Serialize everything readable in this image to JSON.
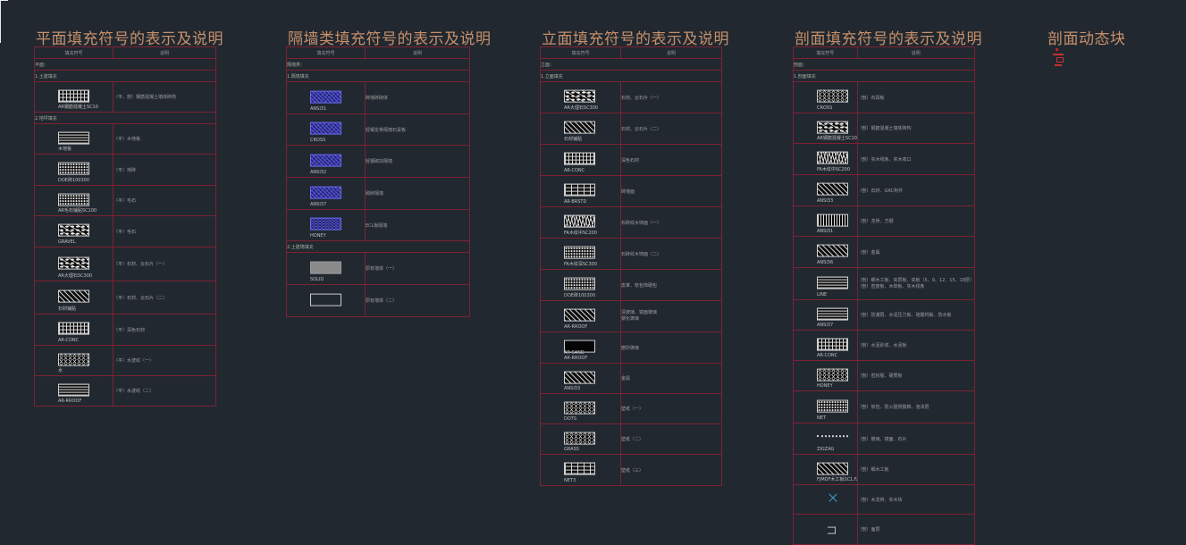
{
  "titles": {
    "plan": "平面填充符号的表示及说明",
    "partition": "隔墙类填充符号的表示及说明",
    "elevation": "立面填充符号的表示及说明",
    "section": "剖面填充符号的表示及说明",
    "dynamic": "剖面动态块"
  },
  "headers": {
    "symbol": "填充符号",
    "desc": "说明"
  },
  "plan": {
    "intro": "平面：",
    "sect1": "1.土建填充",
    "sect2": "2.地坪填充",
    "rows": [
      {
        "pattern": "grid",
        "caption": "AR钢筋混凝土SC10",
        "desc": "（平、剖）钢筋混凝土墙体砖构"
      },
      {
        "pattern": "hlines",
        "caption": "木地板",
        "desc": "（平）木地板"
      },
      {
        "pattern": "dots",
        "caption": "DOE砖100300",
        "desc": "（平）地砖"
      },
      {
        "pattern": "dots",
        "caption": "AR毛石铺贴SC100",
        "desc": "（平）毛石"
      },
      {
        "pattern": "stone",
        "caption": "GRAVEL",
        "desc": "（平）毛石"
      },
      {
        "pattern": "stone",
        "caption": "AR大理石SC300",
        "desc": "（平）石材、云石片（一）"
      },
      {
        "pattern": "diag",
        "caption": "石材铺贴",
        "desc": "（平）石材、云石片（二）"
      },
      {
        "pattern": "grid",
        "caption": "AR-CONC",
        "desc": "（平）深色石材"
      },
      {
        "pattern": "circles",
        "caption": "水",
        "desc": "（平）水波纹（一）"
      },
      {
        "pattern": "hlines",
        "caption": "AR-RROOF",
        "desc": "（平）水波纹（二）"
      }
    ]
  },
  "partition": {
    "intro": "隔墙类：",
    "sect1": "1.隔墙填充",
    "sect2": "2.土建墙填充",
    "rows": [
      {
        "pattern": "blue",
        "caption": "ANSI31",
        "desc": "砖墙砖砌体"
      },
      {
        "pattern": "blue",
        "caption": "CROSS",
        "desc": "轻钢龙骨隔墙石膏板"
      },
      {
        "pattern": "blue",
        "caption": "ANSI32",
        "desc": "轻钢砌块隔墙"
      },
      {
        "pattern": "blue",
        "caption": "ANSI37",
        "desc": "砌砖隔墙"
      },
      {
        "pattern": "blue-hex",
        "caption": "HONEY",
        "desc": "ECL板隔墙"
      },
      {
        "pattern": "gray",
        "caption": "SOLID",
        "desc": "原有墙体（一）"
      },
      {
        "pattern": "empty",
        "caption": "",
        "desc": "原有墙体（二）"
      }
    ]
  },
  "elevation": {
    "intro": "立面：",
    "sect1": "1.立面填充",
    "rows": [
      {
        "pattern": "stone",
        "caption": "AR大理石SC300",
        "desc": "石材、云石片（一）"
      },
      {
        "pattern": "diag",
        "caption": "石材铺贴",
        "desc": "石材、云石片（二）"
      },
      {
        "pattern": "grid",
        "caption": "AR-CONC",
        "desc": "深色石材"
      },
      {
        "pattern": "brick",
        "caption": "AR-BRSTD",
        "desc": "砖墙面"
      },
      {
        "pattern": "wood",
        "caption": "FA木纹中SC200",
        "desc": "石砖纹木饰面（一）"
      },
      {
        "pattern": "dots",
        "caption": "FA木纹深SC300",
        "desc": "石砖纹木饰面（二）"
      },
      {
        "pattern": "dots",
        "caption": "DOE砖100300",
        "desc": "皮革、软包饰硬包"
      },
      {
        "pattern": "diag",
        "caption": "AR-RROOF",
        "desc": "清玻璃、镜面玻璃\n钢化玻璃"
      },
      {
        "pattern": "solid-black",
        "caption": "AR-SAND\nAR-RROOF",
        "desc": "磨砂玻璃"
      },
      {
        "pattern": "diag",
        "caption": "ANSI33",
        "desc": "金属"
      },
      {
        "pattern": "circles",
        "caption": "DOTS",
        "desc": "壁纸（一）"
      },
      {
        "pattern": "circles",
        "caption": "GRASS",
        "desc": "壁纸（二）"
      },
      {
        "pattern": "brick",
        "caption": "NET3",
        "desc": "壁纸（三）"
      }
    ]
  },
  "section": {
    "intro": "剖面：",
    "sect1": "1.剖面填充",
    "rows": [
      {
        "pattern": "circles",
        "caption": "CROSS",
        "desc": "（剖）石膏板"
      },
      {
        "pattern": "stone",
        "caption": "AR钢筋混凝土SC10",
        "desc": "（剖）钢筋混凝土墙体砖构"
      },
      {
        "pattern": "wood",
        "caption": "FA木纹中SC200",
        "desc": "（剖）实木线条、实木收口"
      },
      {
        "pattern": "diag",
        "caption": "ANSI33",
        "desc": "（剖）石材、GRC构件"
      },
      {
        "pattern": "vlines",
        "caption": "ANSI31",
        "desc": "（剖）龙骨、方钢"
      },
      {
        "pattern": "diag",
        "caption": "ANSI36",
        "desc": "（剖）金属"
      },
      {
        "pattern": "hlines",
        "caption": "LINE",
        "desc": "（剖）细木工板、夹层板、夹板（5、9、12、15、18厚）\n（剖）密度板、木饰板、实木线条"
      },
      {
        "pattern": "hlines",
        "caption": "ANSI37",
        "desc": "（剖）防潮层、水泥压力板、硅酸钙板、防水板"
      },
      {
        "pattern": "grid",
        "caption": "AR-CONC",
        "desc": "（剖）水泥砂浆、水泥板"
      },
      {
        "pattern": "circles",
        "caption": "HONEY",
        "desc": "（剖）密封胶、硬质板"
      },
      {
        "pattern": "dots",
        "caption": "NET",
        "desc": "（剖）软包、防火阻燃胶棉、泡沫层"
      },
      {
        "pattern": "line",
        "caption": "ZIGZAG",
        "desc": "（剖）玻璃、镜面、石片"
      },
      {
        "pattern": "diag",
        "caption": "FJMDF木工板SC1.FAT",
        "desc": "（剖）细木工板"
      },
      {
        "pattern": "x",
        "caption": "",
        "desc": "（剖）木龙骨、实木块"
      },
      {
        "pattern": "tag",
        "caption": "",
        "desc": "（剖）面层"
      }
    ]
  }
}
